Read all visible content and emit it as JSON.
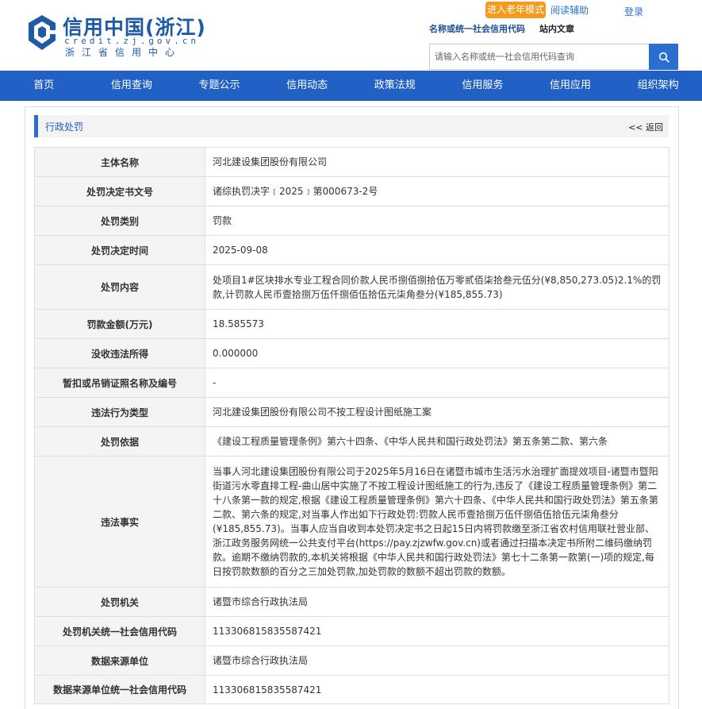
{
  "header": {
    "logo_title": "信用中国(浙江)",
    "logo_url": "credit.zj.gov.cn",
    "logo_org": "浙江省信用中心",
    "elder_mode_label": "进入老年模式",
    "read_assist_label": "阅读辅助",
    "login_label": "登录",
    "search_tab_credit": "名称或统一社会信用代码",
    "search_tab_site": "站内文章",
    "search_placeholder": "请输入名称或统一社会信用代码查询",
    "brand_color": "#1f5aa6",
    "accent_color": "#2160c4",
    "elder_btn_color": "#f59a1c"
  },
  "nav": [
    {
      "label": "首页"
    },
    {
      "label": "信用查询"
    },
    {
      "label": "专题公示"
    },
    {
      "label": "信用动态"
    },
    {
      "label": "政策法规"
    },
    {
      "label": "信用服务"
    },
    {
      "label": "信用应用"
    },
    {
      "label": "组织架构"
    }
  ],
  "panel": {
    "title": "行政处罚",
    "back_label": "<< 返回"
  },
  "details": [
    {
      "key": "主体名称",
      "value": "河北建设集团股份有限公司"
    },
    {
      "key": "处罚决定书文号",
      "value": "诸综执罚决字﹝2025﹞第000673-2号"
    },
    {
      "key": "处罚类别",
      "value": "罚款"
    },
    {
      "key": "处罚决定时间",
      "value": "2025-09-08"
    },
    {
      "key": "处罚内容",
      "value": "处项目1#区块排水专业工程合同价款人民币捌佰捌拾伍万零贰佰柒拾叁元伍分(¥8,850,273.05)2.1%的罚款,计罚款人民币壹拾捌万伍仟捌佰伍拾伍元柒角叁分(¥185,855.73)"
    },
    {
      "key": "罚款金额(万元)",
      "value": "18.585573"
    },
    {
      "key": "没收违法所得",
      "value": "0.000000"
    },
    {
      "key": "暂扣或吊销证照名称及编号",
      "value": "-"
    },
    {
      "key": "违法行为类型",
      "value": "河北建设集团股份有限公司不按工程设计图纸施工案"
    },
    {
      "key": "处罚依据",
      "value": "《建设工程质量管理条例》第六十四条、《中华人民共和国行政处罚法》第五条第二款、第六条"
    },
    {
      "key": "违法事实",
      "value": "当事人河北建设集团股份有限公司于2025年5月16日在诸暨市城市生活污水治理扩面提效项目-诸暨市暨阳街道污水零直排工程-曲山居中实施了不按工程设计图纸施工的行为,违反了《建设工程质量管理条例》第二十八条第一款的规定,根据《建设工程质量管理条例》第六十四条、《中华人民共和国行政处罚法》第五条第二款、第六条的规定,对当事人作出如下行政处罚:罚款人民币壹拾捌万伍仟捌佰伍拾伍元柒角叁分(¥185,855.73)。当事人应当自收到本处罚决定书之日起15日内将罚款缴至浙江省农村信用联社营业部、浙江政务服务网统一公共支付平台(https://pay.zjzwfw.gov.cn)或者通过扫描本决定书所附二维码缴纳罚款。逾期不缴纳罚款的,本机关将根据《中华人民共和国行政处罚法》第七十二条第一款第(一)项的规定,每日按罚款数额的百分之三加处罚款,加处罚款的数额不超出罚款的数额。"
    },
    {
      "key": "处罚机关",
      "value": "诸暨市综合行政执法局"
    },
    {
      "key": "处罚机关统一社会信用代码",
      "value": "113306815835587421"
    },
    {
      "key": "数据来源单位",
      "value": "诸暨市综合行政执法局"
    },
    {
      "key": "数据来源单位统一社会信用代码",
      "value": "113306815835587421"
    }
  ]
}
